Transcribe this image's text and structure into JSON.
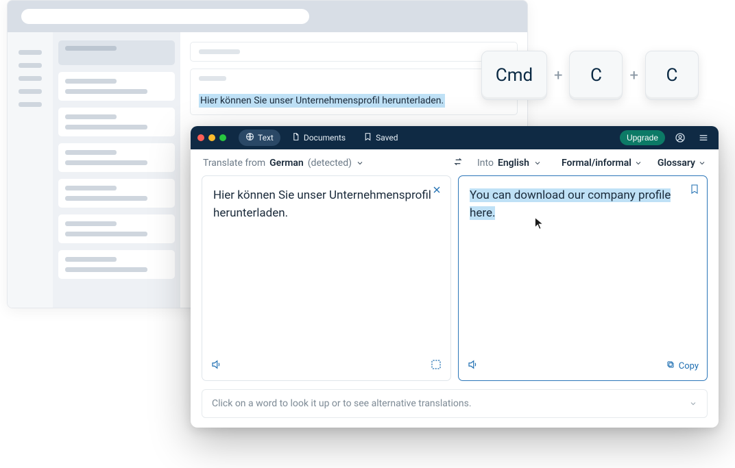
{
  "shortcut": {
    "key1": "Cmd",
    "key2": "C",
    "key3": "C",
    "plus": "+"
  },
  "source_highlight": "Hier können Sie unser Unternehmensprofil herunterladen.",
  "titlebar": {
    "tab_text": "Text",
    "tab_documents": "Documents",
    "tab_saved": "Saved",
    "upgrade": "Upgrade"
  },
  "optbar": {
    "translate_from": "Translate from",
    "source_lang": "German",
    "detected": "(detected)",
    "into": "Into",
    "target_lang": "English",
    "formality": "Formal/informal",
    "glossary": "Glossary"
  },
  "panels": {
    "source_text": "Hier können Sie unser Unternehmensprofil herunterladen.",
    "target_text": "You can download our company profile here.",
    "copy": "Copy"
  },
  "hint": "Click on a word to look it up or to see alternative translations."
}
